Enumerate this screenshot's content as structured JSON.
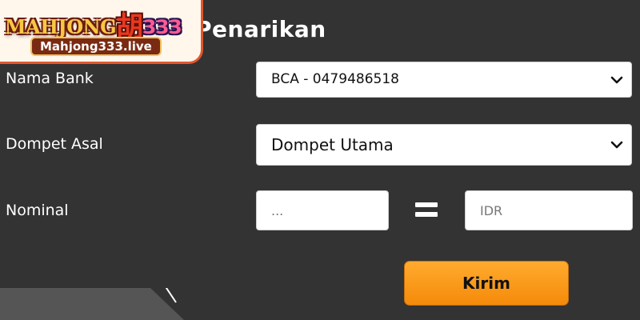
{
  "header": {
    "page_title": "Penarikan",
    "logo": {
      "brand": "MAHJONG",
      "han": "胡",
      "number": "333",
      "domain": "Mahjong333.live"
    }
  },
  "form": {
    "bank": {
      "label": "Nama Bank",
      "selected": "BCA - 0479486518"
    },
    "wallet": {
      "label": "Dompet Asal",
      "selected": "Dompet Utama"
    },
    "amount": {
      "label": "Nominal",
      "placeholder": "...",
      "equals": "=",
      "converted_placeholder": "IDR"
    },
    "submit_label": "Kirim"
  },
  "colors": {
    "background": "#333333",
    "button": "#f7941d",
    "field": "#ffffff",
    "text": "#ffffff"
  },
  "icons": {
    "select_chevron": "chevron-down-icon",
    "equals": "equals-icon"
  }
}
